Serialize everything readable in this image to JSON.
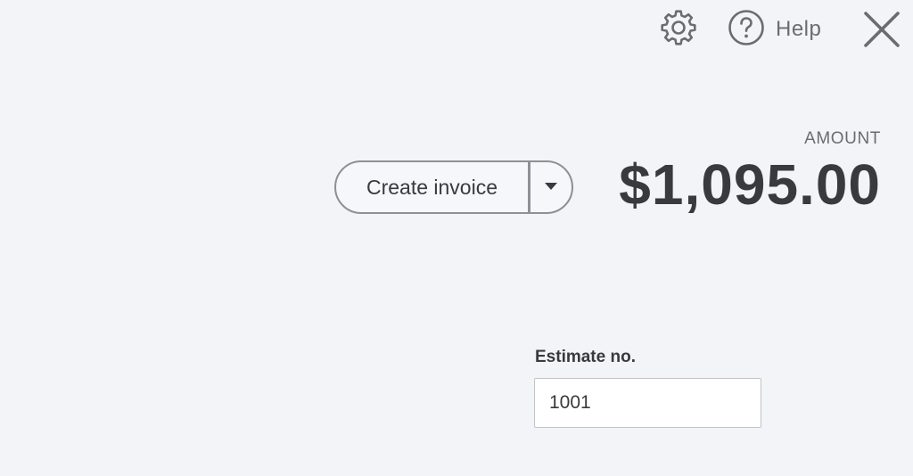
{
  "header": {
    "settings_icon": "gear-icon",
    "help_icon": "question-circle-icon",
    "help_label": "Help",
    "close_icon": "close-icon"
  },
  "summary": {
    "amount_label": "AMOUNT",
    "amount_value": "$1,095.00"
  },
  "actions": {
    "create_invoice_label": "Create invoice",
    "dropdown_icon": "caret-down-icon"
  },
  "form": {
    "estimate_no_label": "Estimate no.",
    "estimate_no_value": "1001"
  },
  "colors": {
    "background": "#f3f4f8",
    "text_primary": "#393a3d",
    "text_secondary": "#6b6c72",
    "button_border": "#8d9096"
  }
}
